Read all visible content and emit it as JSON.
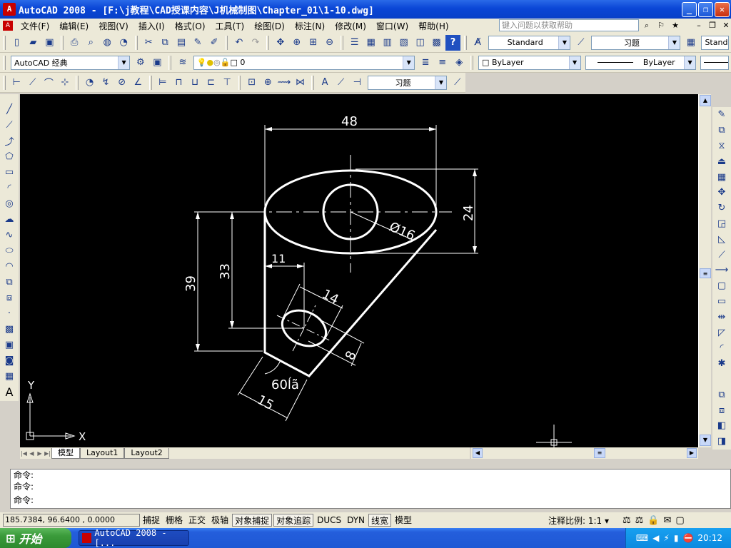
{
  "window": {
    "title": "AutoCAD 2008 - [F:\\j教程\\CAD授课内容\\J机械制图\\Chapter_01\\1-10.dwg]",
    "app_icon": "autocad-logo-icon"
  },
  "menu": [
    "文件(F)",
    "编辑(E)",
    "视图(V)",
    "插入(I)",
    "格式(O)",
    "工具(T)",
    "绘图(D)",
    "标注(N)",
    "修改(M)",
    "窗口(W)",
    "帮助(H)"
  ],
  "help": {
    "placeholder": "键入问题以获取帮助"
  },
  "toolbar": {
    "text_style": "Standard",
    "dim_style": "习题",
    "text_style_right": "Stand",
    "workspace": "AutoCAD 经典",
    "layer": "0",
    "color": "ByLayer",
    "linetype": "ByLayer",
    "dim_combo": "习题"
  },
  "drawing": {
    "dims": {
      "d48": "48",
      "d24": "24",
      "d16": "Ø16",
      "d33": "33",
      "d39": "39",
      "d11": "11",
      "d14": "14",
      "d8": "8",
      "d60": "60ĺã",
      "d15": "15"
    },
    "ucs": {
      "x": "X",
      "y": "Y"
    }
  },
  "tabs": [
    "模型",
    "Layout1",
    "Layout2"
  ],
  "command": {
    "lines": [
      "命令:",
      "命令:"
    ],
    "prompt": "命令:"
  },
  "status": {
    "coords": "185.7384, 96.6400 , 0.0000",
    "buttons": [
      "捕捉",
      "栅格",
      "正交",
      "极轴",
      "对象捕捉",
      "对象追踪",
      "DUCS",
      "DYN",
      "线宽",
      "模型"
    ],
    "scale_label": "注释比例:",
    "scale_value": "1:1"
  },
  "taskbar": {
    "start": "开始",
    "task": "AutoCAD 2008 - [...",
    "clock": "20:12"
  },
  "colors": {
    "canvas": "#000000",
    "geometry": "#ffffff",
    "title": "#0a46d6"
  }
}
